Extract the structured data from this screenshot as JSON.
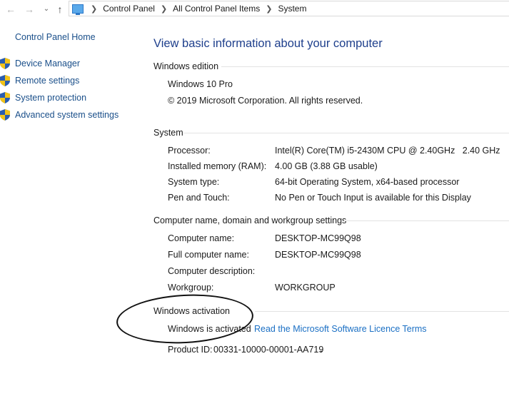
{
  "breadcrumb": {
    "items": [
      "Control Panel",
      "All Control Panel Items",
      "System"
    ]
  },
  "left_pane": {
    "home_link": "Control Panel Home",
    "tasks": [
      {
        "label": "Device Manager",
        "icon": "uac-shield-icon"
      },
      {
        "label": "Remote settings",
        "icon": "uac-shield-icon"
      },
      {
        "label": "System protection",
        "icon": "uac-shield-icon"
      },
      {
        "label": "Advanced system settings",
        "icon": "uac-shield-icon"
      }
    ]
  },
  "main": {
    "title": "View basic information about your computer",
    "windows_edition": {
      "header": "Windows edition",
      "edition": "Windows 10 Pro",
      "copyright": "© 2019 Microsoft Corporation. All rights reserved."
    },
    "system": {
      "header": "System",
      "rows": [
        {
          "label": "Processor:",
          "value": "Intel(R) Core(TM) i5-2430M CPU @ 2.40GHz   2.40 GHz"
        },
        {
          "label": "Installed memory (RAM):",
          "value": "4.00 GB (3.88 GB usable)"
        },
        {
          "label": "System type:",
          "value": "64-bit Operating System, x64-based processor"
        },
        {
          "label": "Pen and Touch:",
          "value": "No Pen or Touch Input is available for this Display"
        }
      ]
    },
    "computer_name": {
      "header": "Computer name, domain and workgroup settings",
      "rows": [
        {
          "label": "Computer name:",
          "value": "DESKTOP-MC99Q98"
        },
        {
          "label": "Full computer name:",
          "value": "DESKTOP-MC99Q98"
        },
        {
          "label": "Computer description:",
          "value": ""
        },
        {
          "label": "Workgroup:",
          "value": "WORKGROUP"
        }
      ]
    },
    "activation": {
      "header": "Windows activation",
      "status": "Windows is activated",
      "license_link": "Read the Microsoft Software Licence Terms",
      "product_id_label": "Product ID:",
      "product_id": "00331-10000-00001-AA719"
    }
  },
  "colors": {
    "title": "#1e3f8c",
    "link": "#1a6fc4",
    "nav_link": "#1a4f8a"
  }
}
